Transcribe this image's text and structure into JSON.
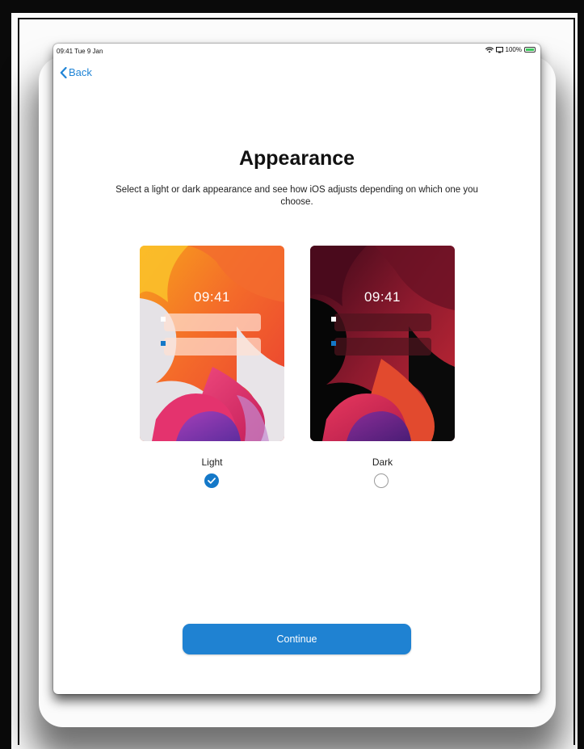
{
  "status_bar": {
    "time": "09:41",
    "date": "Tue 9 Jan",
    "battery": "100%"
  },
  "nav": {
    "back_label": "Back"
  },
  "page": {
    "title": "Appearance",
    "subtitle": "Select a light or dark appearance and see how iOS adjusts depending on which one you choose."
  },
  "options": [
    {
      "label": "Light",
      "preview_time": "09:41",
      "selected": true
    },
    {
      "label": "Dark",
      "preview_time": "09:41",
      "selected": false
    }
  ],
  "actions": {
    "continue_label": "Continue"
  },
  "colors": {
    "accent": "#1f82d2",
    "selected_radio": "#1478c8",
    "battery_fill": "#3bc95b"
  }
}
